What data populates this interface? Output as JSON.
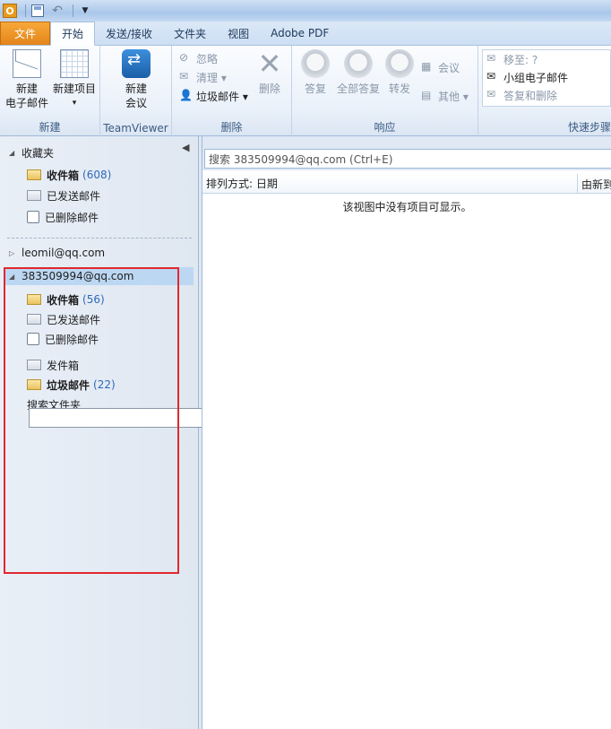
{
  "quick_access": {
    "app_icon_letter": "O"
  },
  "tabs": [
    {
      "label": "文件"
    },
    {
      "label": "开始"
    },
    {
      "label": "发送/接收"
    },
    {
      "label": "文件夹"
    },
    {
      "label": "视图"
    },
    {
      "label": "Adobe PDF"
    }
  ],
  "ribbon": {
    "new_group": {
      "label": "新建",
      "new_email_l1": "新建",
      "new_email_l2": "电子邮件",
      "new_items_l1": "新建项目",
      "new_items_l2": "▾"
    },
    "teamviewer_group": {
      "label": "TeamViewer",
      "new_meeting_l1": "新建",
      "new_meeting_l2": "会议"
    },
    "delete_group": {
      "label": "删除",
      "ignore": "忽略",
      "clean": "清理 ▾",
      "junk": "垃圾邮件 ▾",
      "delete": "删除"
    },
    "respond_group": {
      "label": "响应",
      "reply": "答复",
      "reply_all": "全部答复",
      "forward": "转发",
      "meeting": "会议",
      "more": "其他 ▾"
    },
    "quicksteps_group": {
      "label": "快速步骤",
      "move_to": "移至: ?",
      "team_email": "小组电子邮件",
      "reply_delete": "答复和删除"
    }
  },
  "navpane": {
    "favorites": {
      "label": "收藏夹",
      "items": [
        {
          "label": "收件箱",
          "count": "(608)"
        },
        {
          "label": "已发送邮件"
        },
        {
          "label": "已删除邮件"
        }
      ]
    },
    "account1": {
      "label": "leomil@qq.com"
    },
    "account2": {
      "label": "383509994@qq.com",
      "items": [
        {
          "label": "收件箱",
          "count": "(56)"
        },
        {
          "label": "已发送邮件"
        },
        {
          "label": "已删除邮件"
        },
        {
          "label": "发件箱"
        },
        {
          "label": "垃圾邮件",
          "count": "(22)"
        },
        {
          "label": "搜索文件夹"
        }
      ]
    }
  },
  "main": {
    "search_placeholder": "搜索 383509994@qq.com (Ctrl+E)",
    "sort_label": "排列方式: 日期",
    "sort_order": "由新到旧",
    "empty_message": "该视图中没有项目可显示。"
  }
}
